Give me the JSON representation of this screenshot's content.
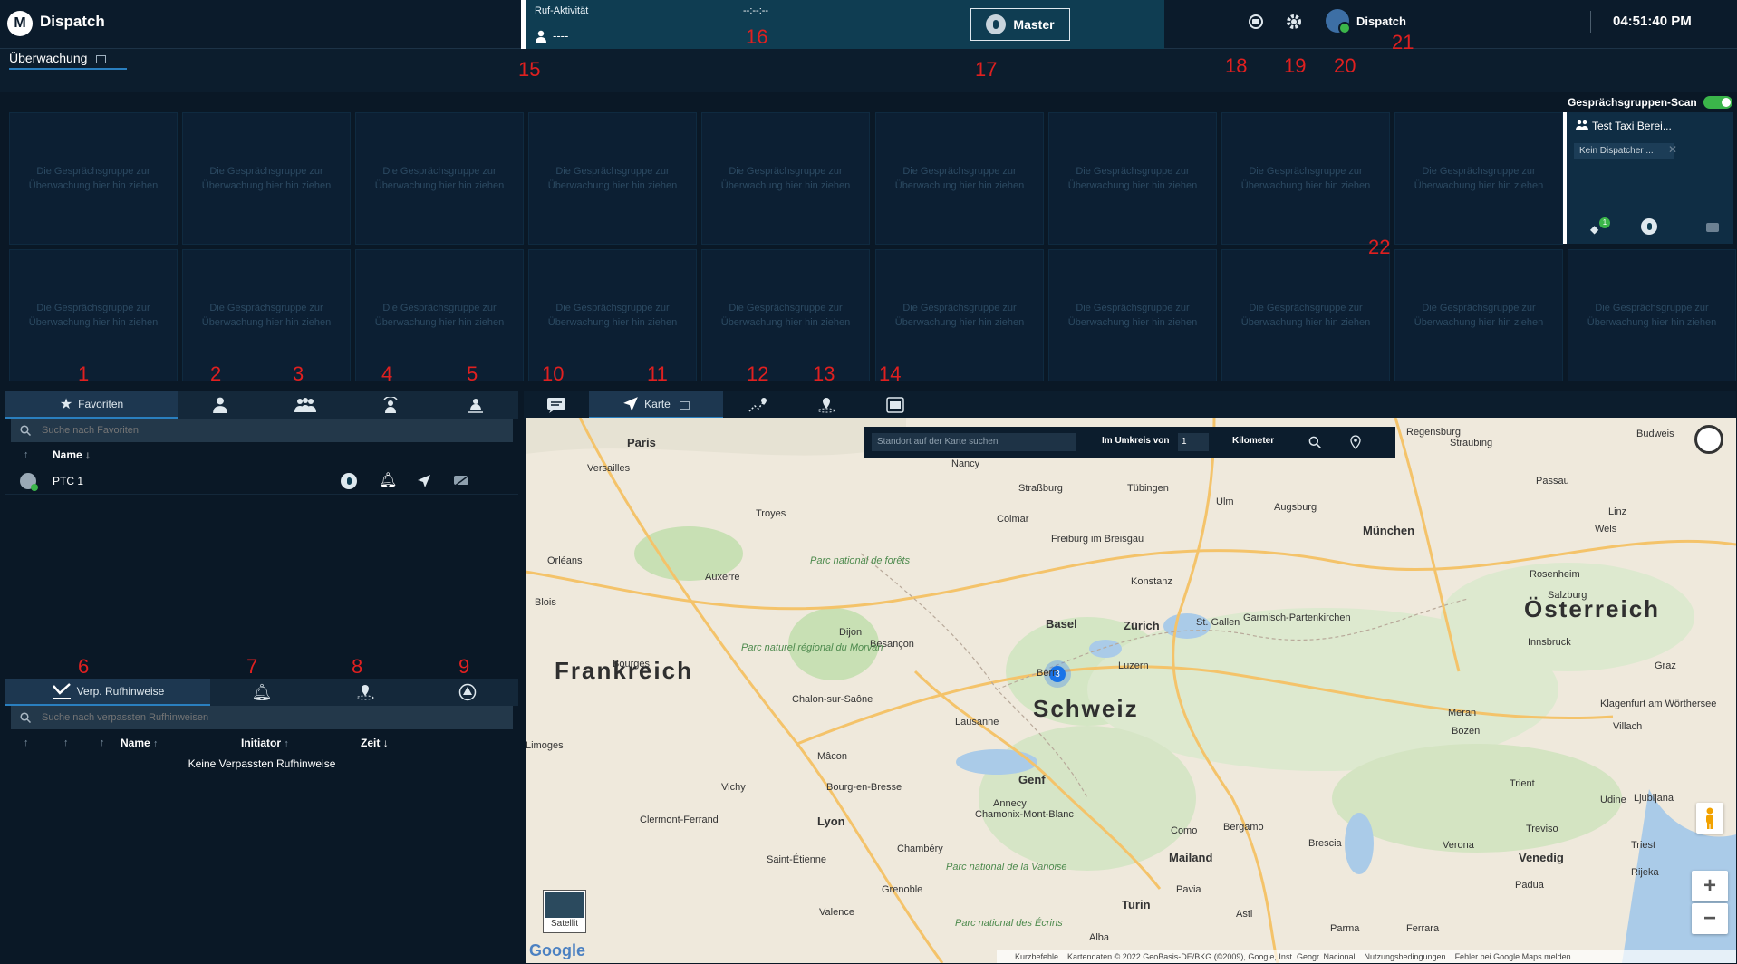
{
  "app": {
    "title": "Dispatch",
    "logo_glyph": "M"
  },
  "call_activity": {
    "label": "Ruf-Aktivität",
    "timer": "--:--:--",
    "caller": "----"
  },
  "master_button": {
    "label": "Master"
  },
  "user": {
    "name": "Dispatch"
  },
  "clock": "04:51:40 PM",
  "monitoring": {
    "tab_label": "Überwachung",
    "drop_hint": "Die Gesprächsgruppe zur Überwachung hier hin ziehen",
    "scan_label": "Gesprächsgruppen-Scan",
    "talkgroup": {
      "name": "Test Taxi Berei...",
      "dispatcher": "Kein Dispatcher ...",
      "badge_count": "1"
    }
  },
  "left_tabs": [
    {
      "label": "Favoriten",
      "icon": "star-icon"
    },
    {
      "label": "",
      "icon": "person-icon"
    },
    {
      "label": "",
      "icon": "group-icon"
    },
    {
      "label": "",
      "icon": "group-broadcast-icon"
    },
    {
      "label": "",
      "icon": "group-download-icon"
    }
  ],
  "favorites": {
    "search_placeholder": "Suche nach Favoriten",
    "name_header": "Name",
    "items": [
      {
        "name": "PTC 1"
      }
    ]
  },
  "calls_tabs": [
    {
      "label": "Verp. Rufhinweise",
      "icon": "missed-call-icon"
    },
    {
      "label": "",
      "icon": "bell-icon"
    },
    {
      "label": "",
      "icon": "location-alert-icon"
    },
    {
      "label": "",
      "icon": "emergency-icon"
    }
  ],
  "missed": {
    "search_placeholder": "Suche nach verpassten Rufhinweisen",
    "headers": [
      "Name",
      "Initiator",
      "Zeit"
    ],
    "empty": "Keine Verpassten Rufhinweise"
  },
  "right_tabs": [
    {
      "label": "",
      "icon": "chat-icon"
    },
    {
      "label": "Karte",
      "icon": "navigation-icon"
    },
    {
      "label": "",
      "icon": "route-icon"
    },
    {
      "label": "",
      "icon": "geofence-icon"
    },
    {
      "label": "",
      "icon": "video-icon"
    }
  ],
  "map_search": {
    "placeholder": "Standort auf der Karte suchen",
    "radius_label": "Im Umkreis von",
    "radius_value": "1",
    "unit": "Kilometer"
  },
  "map": {
    "countries": [
      "Frankreich",
      "Schweiz",
      "Österreich"
    ],
    "cities": [
      "Paris",
      "Versailles",
      "Nancy",
      "Straßburg",
      "Tübingen",
      "Ulm",
      "Augsburg",
      "Regensburg",
      "Straubing",
      "Passau",
      "Troyes",
      "Colmar",
      "Freiburg im Breisgau",
      "München",
      "Linz",
      "Wels",
      "Orléans",
      "Auxerre",
      "Parc national de forêts",
      "Konstanz",
      "Rosenheim",
      "Salzburg",
      "Blois",
      "Basel",
      "Zürich",
      "St. Gallen",
      "Garmisch-Partenkirchen",
      "Dijon",
      "Besançon",
      "Parc naturel régional du Morvan",
      "Innsbruck",
      "Bourges",
      "Luzern",
      "Bern",
      "Graz",
      "Chalon-sur-Saône",
      "Lausanne",
      "Klagenfurt am Wörthersee",
      "Villach",
      "Meran",
      "Bozen",
      "Mâcon",
      "Genf",
      "Bourg-en-Bresse",
      "Vichy",
      "Annecy",
      "Chamonix-Mont-Blanc",
      "Udine",
      "Ljubljana",
      "Trient",
      "Treviso",
      "Clermont-Ferrand",
      "Lyon",
      "Como",
      "Bergamo",
      "Brescia",
      "Verona",
      "Venedig",
      "Triest",
      "Mailand",
      "Chambéry",
      "Saint-Étienne",
      "Parc national de la Vanoise",
      "Rijeka",
      "Grenoble",
      "Pavia",
      "Padua",
      "Turin",
      "Valence",
      "Asti",
      "Parma",
      "Ferrara",
      "Parc national des Écrins",
      "Alba",
      "Budweis",
      "Limoges"
    ],
    "cluster_count": "3",
    "satellite_label": "Satellit",
    "google_label": "Google",
    "attribution": [
      "Kurzbefehle",
      "Kartendaten © 2022 GeoBasis-DE/BKG (©2009), Google, Inst. Geogr. Nacional",
      "Nutzungsbedingungen",
      "Fehler bei Google Maps melden"
    ],
    "zoom_in": "+",
    "zoom_out": "−"
  },
  "annotations": [
    "1",
    "2",
    "3",
    "4",
    "5",
    "6",
    "7",
    "8",
    "9",
    "10",
    "11",
    "12",
    "13",
    "14",
    "15",
    "16",
    "17",
    "18",
    "19",
    "20",
    "21",
    "22"
  ],
  "colors": {
    "background": "#0a1826",
    "accent": "#2a7fbf",
    "online": "#3bb54a",
    "annotation": "#e02020"
  }
}
